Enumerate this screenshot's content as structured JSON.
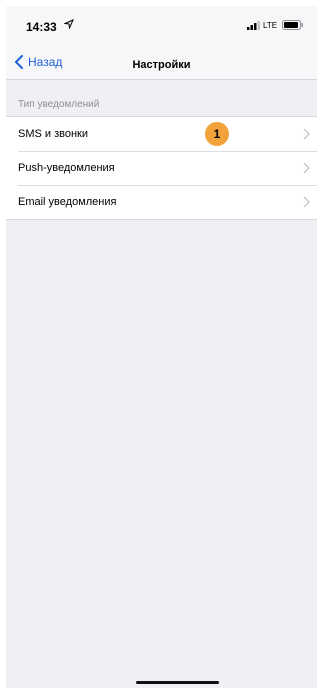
{
  "status_bar": {
    "time": "14:33",
    "network": "LTE",
    "icons": [
      "location-arrow-icon",
      "signal-bars-icon",
      "battery-icon"
    ]
  },
  "nav": {
    "back_label": "Назад",
    "title": "Настройки"
  },
  "section": {
    "header": "Тип уведомлений"
  },
  "items": [
    {
      "label": "SMS и звонки",
      "badge": "1"
    },
    {
      "label": "Push-уведомления"
    },
    {
      "label": "Email уведомления"
    }
  ],
  "colors": {
    "accent": "#1f62d6",
    "badge": "#f2a23a",
    "background": "#efeff4"
  }
}
